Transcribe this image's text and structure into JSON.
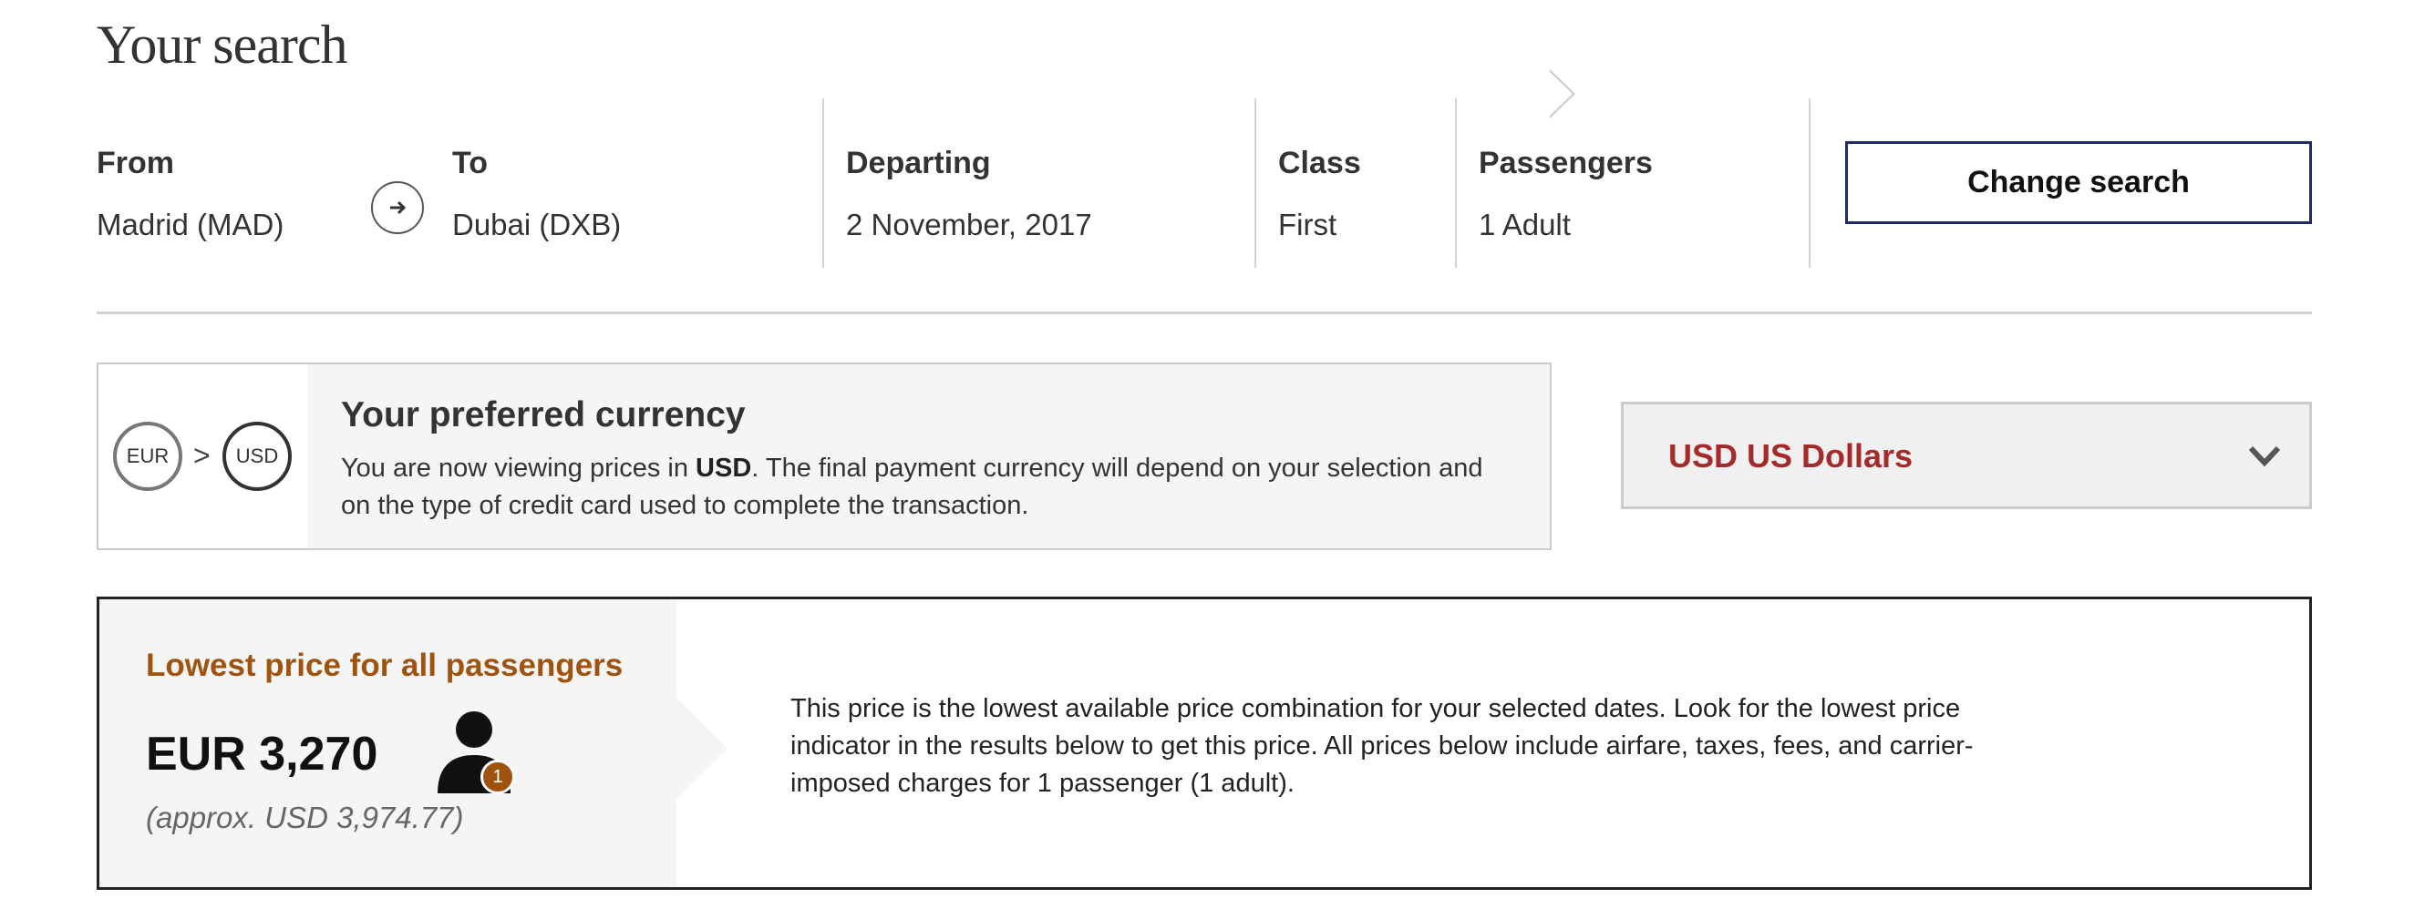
{
  "page": {
    "title": "Your search"
  },
  "search_summary": {
    "from": {
      "label": "From",
      "value": "Madrid (MAD)"
    },
    "to": {
      "label": "To",
      "value": "Dubai (DXB)"
    },
    "departing": {
      "label": "Departing",
      "value": "2 November, 2017"
    },
    "class": {
      "label": "Class",
      "value": "First"
    },
    "passengers": {
      "label": "Passengers",
      "value": "1 Adult"
    },
    "change_button_label": "Change search",
    "route_icon": "arrow-right-circle-icon"
  },
  "currency": {
    "from_code": "EUR",
    "separator": ">",
    "to_code": "USD",
    "title": "Your preferred currency",
    "text_before": "You are now viewing prices in ",
    "text_bold": "USD",
    "text_after": ". The final payment currency will depend on your selection and on the type of credit card used to complete the transaction.",
    "selected_option": "USD US Dollars",
    "dropdown_icon": "chevron-down-icon",
    "selected_color": "#a52a2a"
  },
  "lowest_price": {
    "title": "Lowest price for all passengers",
    "price": "EUR 3,270",
    "approx": "(approx. USD 3,974.77)",
    "passenger_count_badge": "1",
    "passenger_icon": "person-icon",
    "description": "This price is the lowest available price combination for your selected dates. Look for the lowest price indicator in the results below to get this price. All prices below include airfare, taxes, fees, and carrier-imposed charges for 1 passenger (1 adult).",
    "title_color": "#a0530f"
  }
}
